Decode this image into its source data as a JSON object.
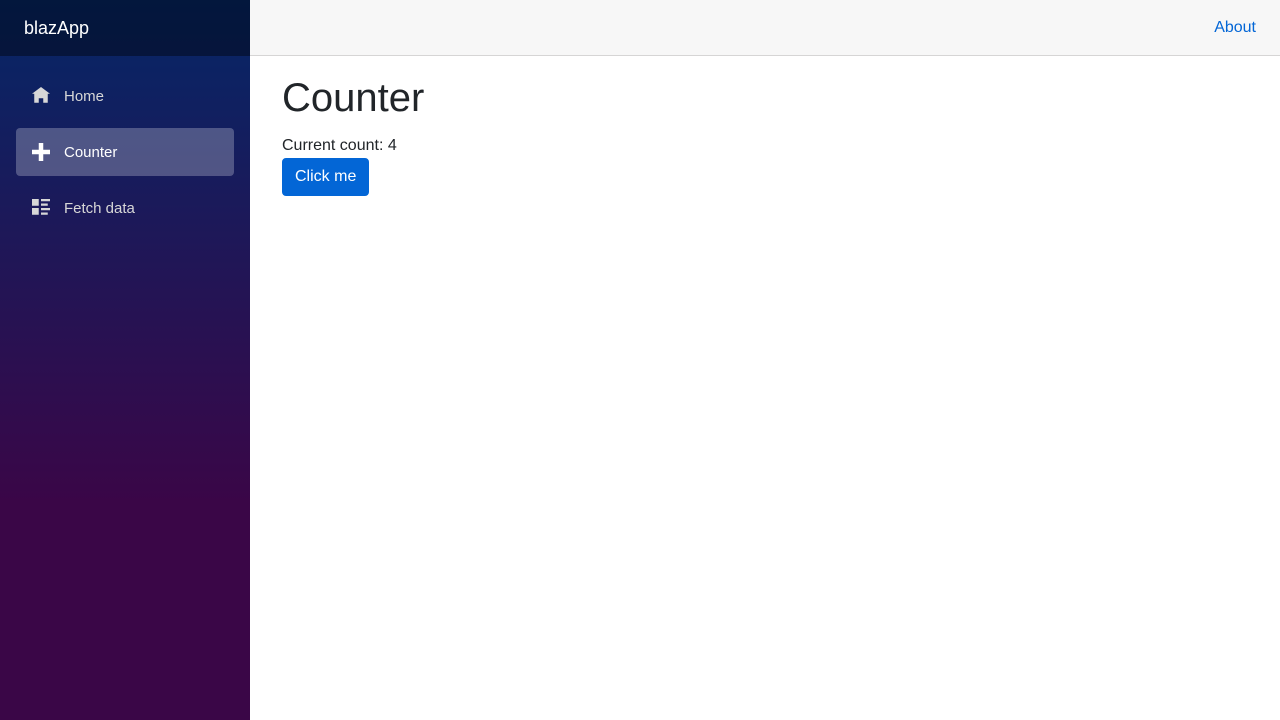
{
  "brand": "blazApp",
  "nav": {
    "items": [
      {
        "label": "Home",
        "icon": "home-icon"
      },
      {
        "label": "Counter",
        "icon": "plus-icon",
        "active": true
      },
      {
        "label": "Fetch data",
        "icon": "list-rich-icon"
      }
    ]
  },
  "topbar": {
    "about_label": "About"
  },
  "page": {
    "title": "Counter",
    "count_label": "Current count: 4",
    "button_label": "Click me"
  },
  "colors": {
    "accent": "#0366d6",
    "sidebar_top": "#052767",
    "sidebar_bottom": "#3a0647"
  }
}
